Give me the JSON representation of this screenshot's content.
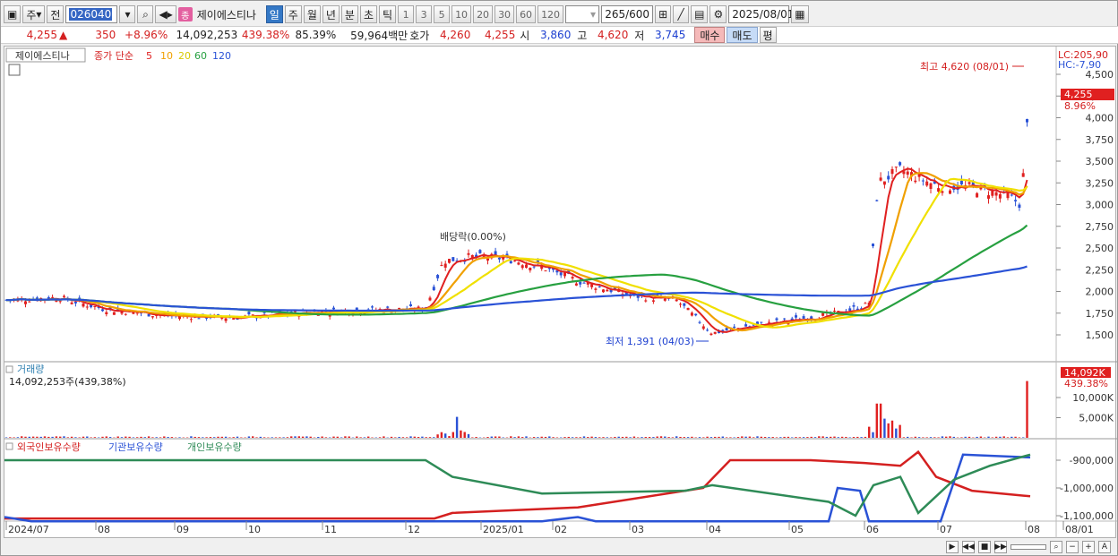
{
  "toolbar": {
    "menu1": "주",
    "menu2": "전",
    "code": "026040",
    "badge": "종",
    "stock_name": "제이에스티나",
    "periods": [
      "일",
      "주",
      "월",
      "년",
      "분",
      "초",
      "틱"
    ],
    "active_period": "일",
    "minutes": [
      "1",
      "3",
      "5",
      "10",
      "20",
      "30",
      "60",
      "120"
    ],
    "count": "265",
    "count_total": "/600",
    "date": "2025/08/01"
  },
  "quote": {
    "price": "4,255",
    "change": "350",
    "change_pct": "+8.96%",
    "volume": "14,092,253",
    "vol_pct": "439.38%",
    "ratio": "85.39%",
    "amount": "59,964백만",
    "hoga_label": "호가",
    "bid": "4,260",
    "ask": "4,255",
    "open_label": "시",
    "open": "3,860",
    "high_label": "고",
    "high": "4,620",
    "low_label": "저",
    "low": "3,745",
    "buy_label": "매수",
    "sell_label": "매도",
    "avg_label": "평"
  },
  "price_pane": {
    "stock_name": "제이에스티나",
    "ma_title": "종가 단순",
    "ma_periods": [
      "5",
      "10",
      "20",
      "60",
      "120"
    ],
    "ma_colors": [
      "#e02020",
      "#f0a000",
      "#f0e000",
      "#27a040",
      "#2a52d6"
    ],
    "lc": "LC:205,90",
    "hc": "HC:-7,90",
    "last_price": "4,255",
    "last_pct": "8.96%",
    "high_note": "최고 4,620 (08/01)",
    "low_note": "최저 1,391 (04/03)",
    "dividend_note": "배당락(0.00%)",
    "y_ticks": [
      "4,500",
      "4,250",
      "4,000",
      "3,750",
      "3,500",
      "3,250",
      "3,000",
      "2,750",
      "2,500",
      "2,250",
      "2,000",
      "1,750",
      "1,500"
    ],
    "y_values": [
      4500,
      4250,
      4000,
      3750,
      3500,
      3250,
      3000,
      2750,
      2500,
      2250,
      2000,
      1750,
      1500
    ]
  },
  "volume_pane": {
    "title": "거래량",
    "value": "14,092,253주(439,38%)",
    "last": "14,092K",
    "last_pct": "439.38%",
    "y_ticks": [
      "10,000K",
      "5,000K"
    ]
  },
  "holding_pane": {
    "labels": [
      "외국인보유수량",
      "기관보유수량",
      "개인보유수량"
    ],
    "colors": [
      "#d42020",
      "#2a52d6",
      "#2e8b57"
    ],
    "y_ticks": [
      "-900,000",
      "-1,000,000",
      "-1,100,000"
    ],
    "y_values": [
      -900000,
      -1000000,
      -1100000
    ]
  },
  "x_axis": [
    "2024/07",
    "08",
    "09",
    "10",
    "11",
    "12",
    "2025/01",
    "02",
    "03",
    "04",
    "05",
    "06",
    "07",
    "08",
    "08/01"
  ]
}
